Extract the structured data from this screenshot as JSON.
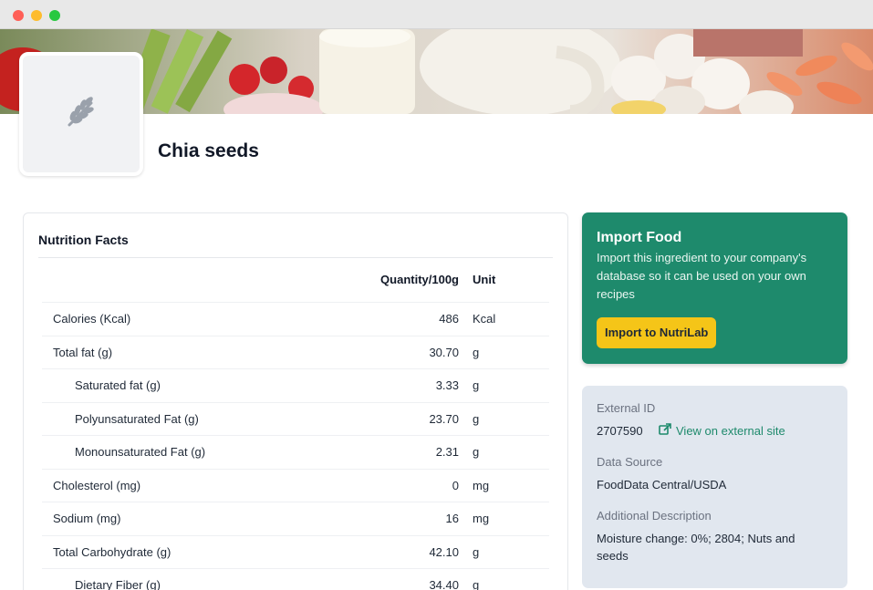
{
  "window": {
    "controls": [
      "close",
      "minimize",
      "maximize"
    ]
  },
  "food": {
    "name": "Chia seeds",
    "placeholder_icon": "wheat-icon"
  },
  "nutrition": {
    "title": "Nutrition Facts",
    "headers": {
      "quantity": "Quantity/100g",
      "unit": "Unit"
    },
    "rows": [
      {
        "name": "Calories (Kcal)",
        "qty": "486",
        "unit": "Kcal",
        "indent": false
      },
      {
        "name": "Total fat (g)",
        "qty": "30.70",
        "unit": "g",
        "indent": false
      },
      {
        "name": "Saturated fat (g)",
        "qty": "3.33",
        "unit": "g",
        "indent": true
      },
      {
        "name": "Polyunsaturated Fat (g)",
        "qty": "23.70",
        "unit": "g",
        "indent": true
      },
      {
        "name": "Monounsaturated Fat (g)",
        "qty": "2.31",
        "unit": "g",
        "indent": true
      },
      {
        "name": "Cholesterol (mg)",
        "qty": "0",
        "unit": "mg",
        "indent": false
      },
      {
        "name": "Sodium (mg)",
        "qty": "16",
        "unit": "mg",
        "indent": false
      },
      {
        "name": "Total Carbohydrate (g)",
        "qty": "42.10",
        "unit": "g",
        "indent": false
      },
      {
        "name": "Dietary Fiber (g)",
        "qty": "34.40",
        "unit": "g",
        "indent": true
      }
    ]
  },
  "import": {
    "title": "Import Food",
    "text": "Import this ingredient to your company's database so it can be used on your own recipes",
    "button": "Import to NutriLab"
  },
  "details": {
    "external_id_label": "External ID",
    "external_id": "2707590",
    "external_link": "View on external site",
    "source_label": "Data Source",
    "source": "FoodData Central/USDA",
    "description_label": "Additional Description",
    "description": "Moisture change: 0%; 2804; Nuts and seeds"
  },
  "colors": {
    "accent": "#1e8a6c",
    "button": "#f5c518",
    "info_bg": "#e1e7ef"
  }
}
